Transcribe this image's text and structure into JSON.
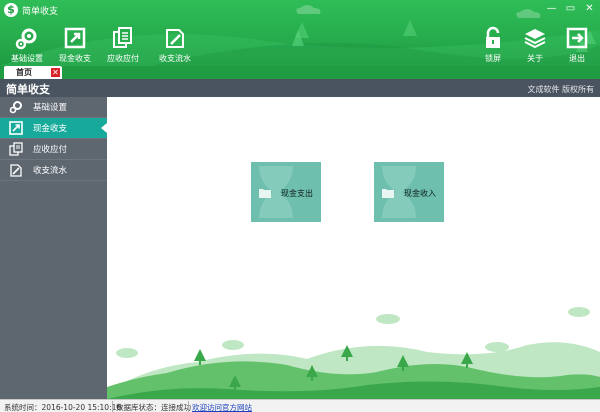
{
  "window": {
    "title": "简单收支",
    "controls": [
      "minimize",
      "maximize",
      "close"
    ]
  },
  "toolbar": {
    "left": [
      {
        "label": "基础设置",
        "icon": "gears-icon"
      },
      {
        "label": "现金收支",
        "icon": "external-link-icon"
      },
      {
        "label": "应收应付",
        "icon": "documents-icon"
      },
      {
        "label": "收支流水",
        "icon": "ledger-icon"
      }
    ],
    "right": [
      {
        "label": "锁屏",
        "icon": "lock-icon"
      },
      {
        "label": "关于",
        "icon": "layers-icon"
      },
      {
        "label": "退出",
        "icon": "exit-icon"
      }
    ]
  },
  "tabs": [
    {
      "label": "首页",
      "closable": true
    }
  ],
  "header": {
    "title": "简单收支",
    "right_text": "文成软件  版权所有"
  },
  "sidebar": {
    "items": [
      {
        "label": "基础设置",
        "icon": "gears-icon",
        "active": false
      },
      {
        "label": "现金收支",
        "icon": "external-link-icon",
        "active": true
      },
      {
        "label": "应收应付",
        "icon": "documents-icon",
        "active": false
      },
      {
        "label": "收支流水",
        "icon": "ledger-icon",
        "active": false
      }
    ]
  },
  "main": {
    "tiles": [
      {
        "label": "现金支出",
        "icon": "folder-icon"
      },
      {
        "label": "现金收入",
        "icon": "folder-icon"
      }
    ]
  },
  "status": {
    "system_time": "系统时间：2016-10-20 15:10:16",
    "db_status": "数据库状态：连接成功",
    "link": "欢迎访问官方网站"
  },
  "colors": {
    "brand_green": "#27ad4d",
    "accent_teal": "#17a99a",
    "sidebar": "#5e6670",
    "tile": "#6ebfae"
  }
}
